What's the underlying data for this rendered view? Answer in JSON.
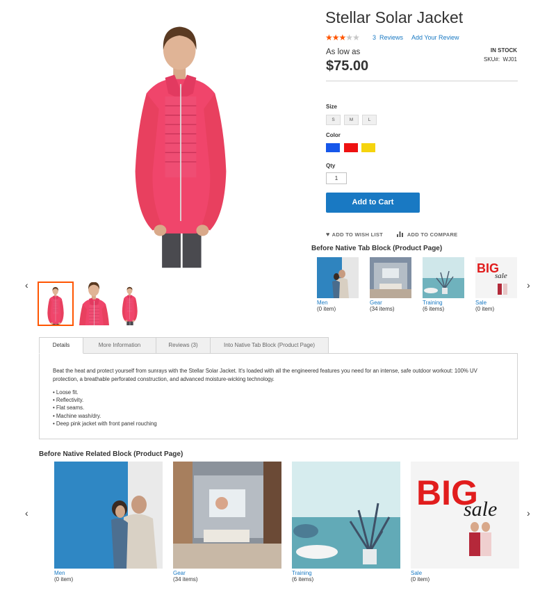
{
  "product": {
    "title": "Stellar Solar Jacket",
    "rating_fraction": 0.7,
    "reviews_count_label": "3",
    "reviews_word": "Reviews",
    "add_review": "Add Your Review",
    "as_low_as": "As low as",
    "price": "$75.00",
    "stock": "IN STOCK",
    "sku_label": "SKU#:",
    "sku": "WJ01",
    "colors": {
      "accent": "#1979c3",
      "star": "#ff5501",
      "jacket": "#f0456b"
    }
  },
  "options": {
    "size_label": "Size",
    "sizes": [
      "S",
      "M",
      "L"
    ],
    "color_label": "Color",
    "color_swatches": [
      "#1657ea",
      "#ee1111",
      "#f5d40e"
    ],
    "qty_label": "Qty",
    "qty_value": "1"
  },
  "actions": {
    "add_to_cart": "Add to Cart",
    "wish_list": "ADD TO WISH LIST",
    "compare": "ADD TO COMPARE",
    "wish_icon": "heart-icon",
    "compare_icon": "bar-chart-icon",
    "prev_icon": "chevron-left-icon",
    "next_icon": "chevron-right-icon"
  },
  "tab_block": {
    "title": "Before Native Tab Block (Product Page)",
    "categories": [
      {
        "name": "Men",
        "count": "(0 item)"
      },
      {
        "name": "Gear",
        "count": "(34 items)"
      },
      {
        "name": "Training",
        "count": "(6 items)"
      },
      {
        "name": "Sale",
        "count": "(0 item)"
      }
    ]
  },
  "tabs": [
    "Details",
    "More Information",
    "Reviews (3)",
    "Into Native Tab Block (Product Page)"
  ],
  "details": {
    "description": "Beat the heat and protect yourself from sunrays with the Stellar Solar Jacket. It's loaded with all the engineered features you need for an intense, safe outdoor workout: 100% UV protection, a breathable perforated construction, and advanced moisture-wicking technology.",
    "bullets": [
      "• Loose fit.",
      "• Reflectivity.",
      "• Flat seams.",
      "• Machine wash/dry.",
      "• Deep pink jacket with front panel rouching"
    ]
  },
  "related_block": {
    "title": "Before Native Related Block (Product Page)",
    "categories": [
      {
        "name": "Men",
        "count": "(0 item)"
      },
      {
        "name": "Gear",
        "count": "(34 items)"
      },
      {
        "name": "Training",
        "count": "(6 items)"
      },
      {
        "name": "Sale",
        "count": "(0 item)"
      }
    ]
  },
  "sale_graphic": {
    "big": "BIG",
    "sale": "sale"
  }
}
